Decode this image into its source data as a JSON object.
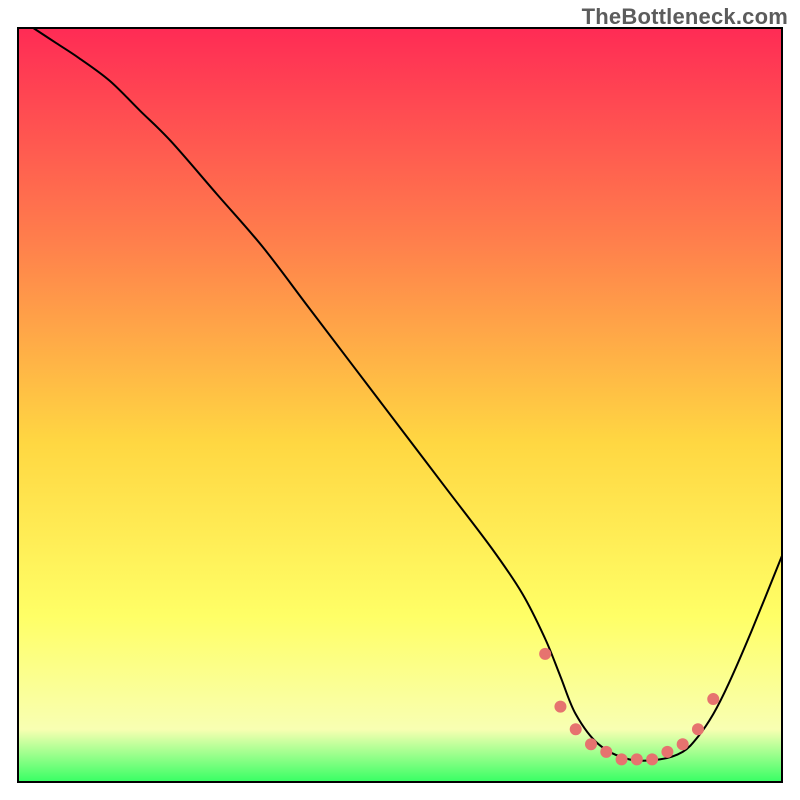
{
  "watermark": "TheBottleneck.com",
  "chart_data": {
    "type": "line",
    "title": "",
    "xlabel": "",
    "ylabel": "",
    "xlim": [
      0,
      100
    ],
    "ylim": [
      0,
      100
    ],
    "grid": false,
    "legend": false,
    "background_gradient": {
      "top": "#ff2b55",
      "mid_upper": "#ff7e4c",
      "mid": "#ffd742",
      "mid_lower": "#ffff66",
      "near_bottom": "#f8ffb2",
      "bottom": "#37ff64"
    },
    "series": [
      {
        "name": "bottleneck-curve",
        "color": "#000000",
        "stroke_width": 2,
        "x": [
          2,
          5,
          8,
          12,
          16,
          20,
          26,
          32,
          38,
          44,
          50,
          56,
          62,
          66,
          69,
          71,
          73,
          76,
          80,
          84,
          87,
          89,
          91,
          93,
          96,
          100
        ],
        "y": [
          100,
          98,
          96,
          93,
          89,
          85,
          78,
          71,
          63,
          55,
          47,
          39,
          31,
          25,
          19,
          14,
          9,
          5,
          3,
          3,
          4,
          6,
          9,
          13,
          20,
          30
        ]
      }
    ],
    "markers": {
      "name": "optimal-range-dots",
      "color": "#e6736f",
      "radius": 6,
      "x": [
        69,
        71,
        73,
        75,
        77,
        79,
        81,
        83,
        85,
        87,
        89,
        91
      ],
      "y": [
        17,
        10,
        7,
        5,
        4,
        3,
        3,
        3,
        4,
        5,
        7,
        11
      ]
    }
  }
}
